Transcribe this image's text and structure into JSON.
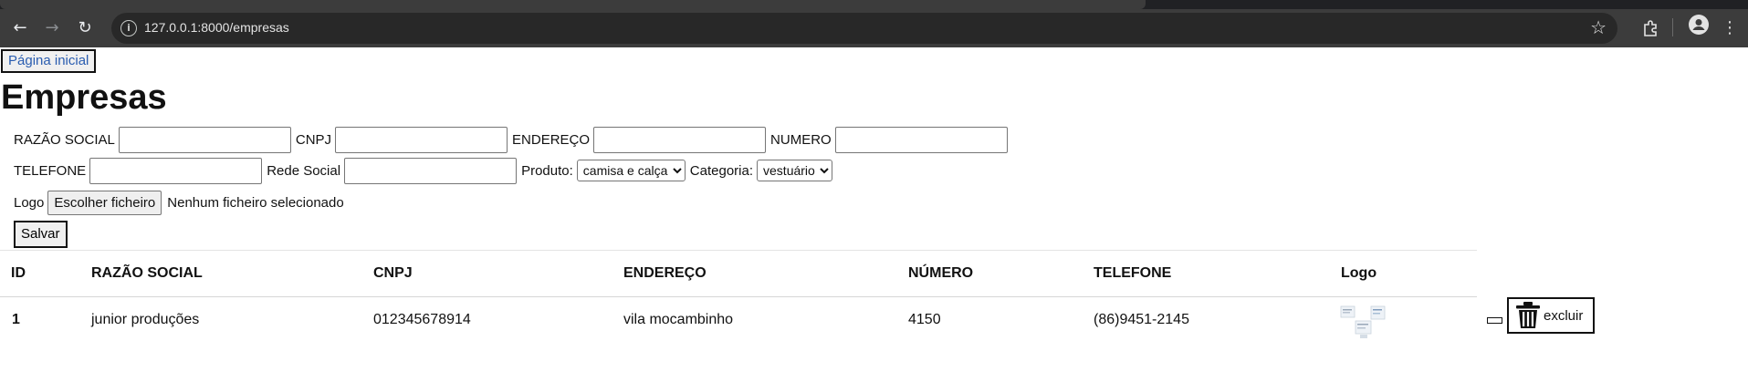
{
  "browser": {
    "url": "127.0.0.1:8000/empresas",
    "icons": [
      "back-arrow-icon",
      "forward-arrow-icon",
      "reload-icon",
      "site-info-icon",
      "bookmark-star-icon",
      "extensions-icon",
      "profile-icon",
      "more-menu-icon"
    ]
  },
  "page": {
    "home_link": "Página inicial",
    "title": "Empresas"
  },
  "form": {
    "razao_social_label": "RAZÃO SOCIAL",
    "cnpj_label": "CNPJ",
    "endereco_label": "ENDEREÇO",
    "numero_label": "NUMERO",
    "telefone_label": "TELEFONE",
    "rede_social_label": "Rede Social",
    "produto_label": "Produto:",
    "produto_selected": "camisa e calça",
    "categoria_label": "Categoria:",
    "categoria_selected": "vestuário",
    "logo_label": "Logo",
    "file_button": "Escolher ficheiro",
    "file_status": "Nenhum ficheiro selecionado",
    "save_button": "Salvar"
  },
  "table": {
    "headers": [
      "ID",
      "RAZÃO SOCIAL",
      "CNPJ",
      "ENDEREÇO",
      "NÚMERO",
      "TELEFONE",
      "Logo"
    ],
    "rows": [
      {
        "id": "1",
        "razao_social": "junior produções",
        "cnpj": "012345678914",
        "endereco": "vila mocambinho",
        "numero": "4150",
        "telefone": "(86)9451-2145",
        "delete_label": "excluir"
      }
    ]
  }
}
